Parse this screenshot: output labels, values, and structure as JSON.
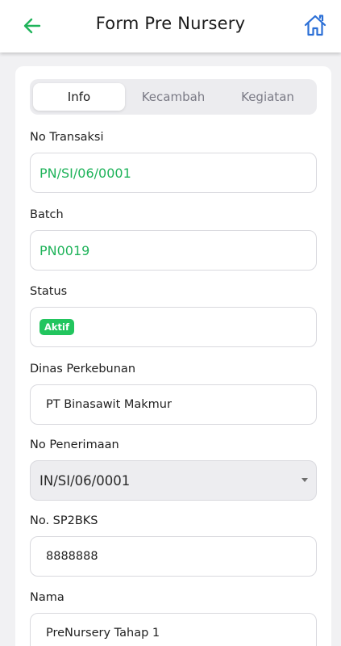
{
  "appbar": {
    "title": "Form Pre Nursery",
    "back_icon": "arrow-left-icon",
    "home_icon": "home-icon"
  },
  "colors": {
    "accent_green": "#1fb35a",
    "home_icon_blue": "#2b6fd6",
    "badge_green": "#22c55e"
  },
  "tabs": [
    {
      "label": "Info",
      "active": true
    },
    {
      "label": "Kecambah",
      "active": false
    },
    {
      "label": "Kegiatan",
      "active": false
    }
  ],
  "form": {
    "no_transaksi": {
      "label": "No Transaksi",
      "value": "PN/SI/06/0001"
    },
    "batch": {
      "label": "Batch",
      "value": "PN0019"
    },
    "status": {
      "label": "Status",
      "value": "Aktif"
    },
    "dinas": {
      "label": "Dinas Perkebunan",
      "value": "PT Binasawit Makmur"
    },
    "no_penerimaan": {
      "label": "No Penerimaan",
      "value": "IN/SI/06/0001"
    },
    "sp2bks": {
      "label": "No. SP2BKS",
      "value": "8888888"
    },
    "nama": {
      "label": "Nama",
      "value": "PreNursery Tahap 1"
    }
  }
}
